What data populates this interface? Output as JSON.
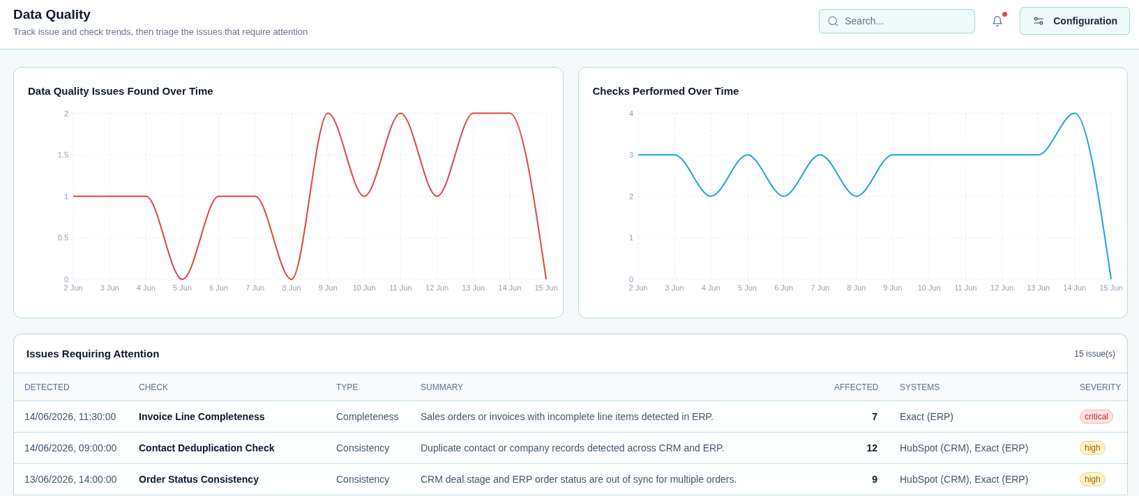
{
  "header": {
    "title": "Data Quality",
    "subtitle": "Track issue and check trends, then triage the issues that require attention",
    "search": {
      "placeholder": "Search..."
    },
    "notifications": {
      "unread": true
    },
    "configuration_button": "Configuration"
  },
  "charts": [
    {
      "chart_data": {
        "type": "line",
        "title": "Data Quality Issues Found Over Time",
        "categories": [
          "2 Jun",
          "3 Jun",
          "4 Jun",
          "5 Jun",
          "6 Jun",
          "7 Jun",
          "8 Jun",
          "9 Jun",
          "10 Jun",
          "11 Jun",
          "12 Jun",
          "13 Jun",
          "14 Jun",
          "15 Jun"
        ],
        "series": [
          {
            "color": "#e04646",
            "values": [
              1,
              1,
              1,
              0,
              1,
              1,
              0,
              2,
              1,
              2,
              1,
              2,
              2,
              0
            ]
          }
        ],
        "ylim": [
          0,
          2
        ],
        "yticks": [
          0,
          0.5,
          1,
          1.5,
          2
        ],
        "grid": true
      }
    },
    {
      "chart_data": {
        "type": "line",
        "title": "Checks Performed Over Time",
        "categories": [
          "2 Jun",
          "3 Jun",
          "4 Jun",
          "5 Jun",
          "6 Jun",
          "7 Jun",
          "8 Jun",
          "9 Jun",
          "10 Jun",
          "11 Jun",
          "12 Jun",
          "13 Jun",
          "14 Jun",
          "15 Jun"
        ],
        "series": [
          {
            "color": "#1ea3db",
            "values": [
              3,
              3,
              2,
              3,
              2,
              3,
              2,
              3,
              3,
              3,
              3,
              3,
              4,
              0
            ]
          }
        ],
        "ylim": [
          0,
          4
        ],
        "yticks": [
          0,
          1,
          2,
          3,
          4
        ],
        "grid": true
      }
    }
  ],
  "issues": {
    "title": "Issues Requiring Attention",
    "count": "15 issue(s)",
    "columns": [
      "DETECTED",
      "CHECK",
      "TYPE",
      "SUMMARY",
      "AFFECTED",
      "SYSTEMS",
      "SEVERITY"
    ],
    "rows": [
      {
        "detected": "14/06/2026, 11:30:00",
        "check": "Invoice Line Completeness",
        "type": "Completeness",
        "summary": "Sales orders or invoices with incomplete line items detected in ERP.",
        "affected": "7",
        "systems": "Exact (ERP)",
        "severity": {
          "label": "critical",
          "kind": "critical"
        }
      },
      {
        "detected": "14/06/2026, 09:00:00",
        "check": "Contact Deduplication Check",
        "type": "Consistency",
        "summary": "Duplicate contact or company records detected across CRM and ERP.",
        "affected": "12",
        "systems": "HubSpot (CRM), Exact (ERP)",
        "severity": {
          "label": "high",
          "kind": "high"
        }
      },
      {
        "detected": "13/06/2026, 14:00:00",
        "check": "Order Status Consistency",
        "type": "Consistency",
        "summary": "CRM deal stage and ERP order status are out of sync for multiple orders.",
        "affected": "9",
        "systems": "HubSpot (CRM), Exact (ERP)",
        "severity": {
          "label": "high",
          "kind": "high"
        }
      }
    ]
  }
}
